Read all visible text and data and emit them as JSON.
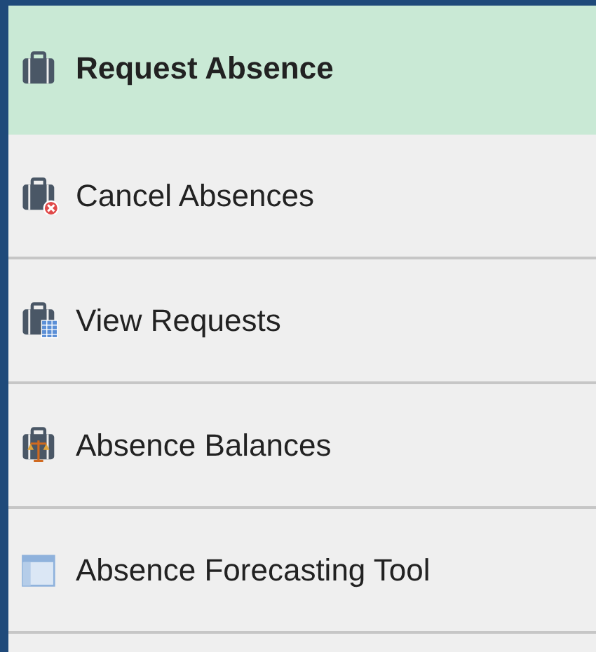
{
  "menu": {
    "items": [
      {
        "label": "Request Absence",
        "kind": "briefcase",
        "selected": true
      },
      {
        "label": "Cancel Absences",
        "kind": "briefcase-cancel",
        "selected": false
      },
      {
        "label": "View Requests",
        "kind": "briefcase-calendar",
        "selected": false
      },
      {
        "label": "Absence Balances",
        "kind": "briefcase-scale",
        "selected": false
      },
      {
        "label": "Absence Forecasting Tool",
        "kind": "window",
        "selected": false
      }
    ]
  }
}
